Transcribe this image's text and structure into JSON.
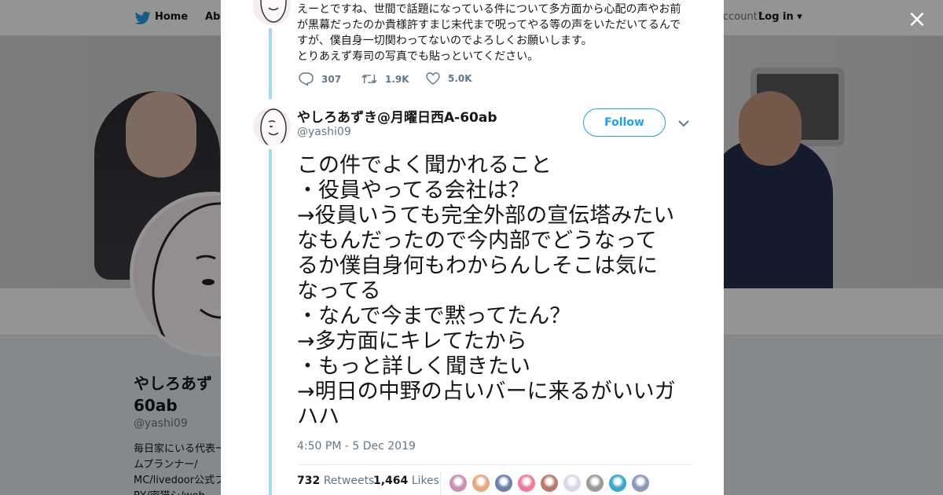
{
  "background": {
    "nav": {
      "home_label": "Home",
      "about_label": "Abo",
      "account_prompt": "ccount?",
      "login_label": "Log in"
    },
    "profile": {
      "name": "やしろあず",
      "name_line2": "60ab",
      "handle": "@yashi09",
      "bio": "毎日家にいる代表ームプランナー/ MC/livedoor公式ブRY/密猫シ/web"
    }
  },
  "modal": {
    "close_label": "×",
    "previous_tweet": {
      "lines": [
        "えーとですね、世間で話題になっている件について多方面から心配の声やお前",
        "が黒幕だったのか貴様許すまじ末代まで呪ってやる等の声をいただいてるんで",
        "すが、僕自身一切関わってないのでよろしくお願いします。",
        "とりあえず寿司の写真でも貼っといてください。"
      ],
      "replies": "307",
      "retweets": "1.9K",
      "likes": "5.0K"
    },
    "tweet": {
      "author_name": "やしろあずき@月曜日西A-60ab",
      "author_handle": "@yashi09",
      "follow_label": "Follow",
      "lines": [
        "この件でよく聞かれること",
        "・役員やってる会社は？",
        "→役員いうても完全外部の宣伝塔みたい",
        "なもんだったので今内部でどうなって",
        "るか僕自身何もわからんしそこは気に",
        "なってる",
        "・なんで今まで黙ってたん？",
        "→多方面にキレてたから",
        "・もっと詳しく聞きたい",
        "→明日の中野の占いバーに来るがいいガ",
        "ハハ"
      ],
      "timestamp": "4:50 PM - 5 Dec 2019",
      "retweet_count": "732",
      "retweet_label": "Retweets",
      "like_count": "1,464",
      "like_label": "Likes"
    },
    "colors": {
      "accent": "#1da1f2",
      "thread_line": "#a8d8f8",
      "text": "#14171a",
      "muted": "#657786"
    },
    "liker_avatar_colors": [
      "#c98fb0",
      "#e8a87c",
      "#6b7fa8",
      "#f07a9a",
      "#b97a6e",
      "#d8d8e8",
      "#9a9a9a",
      "#3aa8c8",
      "#8a9ab8"
    ]
  }
}
